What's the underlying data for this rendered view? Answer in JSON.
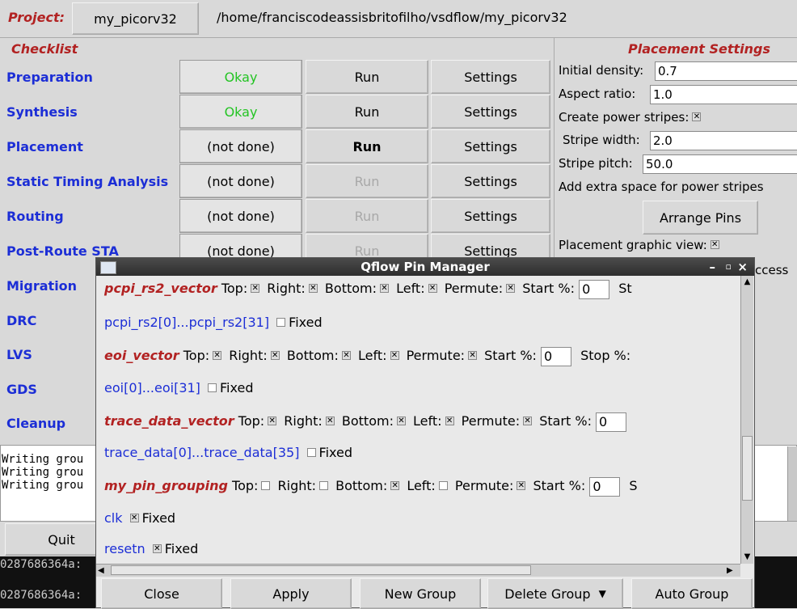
{
  "header": {
    "project_label": "Project:",
    "project_name": "my_picorv32",
    "project_path": "/home/franciscodeassisbritofilho/vsdflow/my_picorv32"
  },
  "checklist": {
    "title": "Checklist",
    "rows": [
      {
        "label": "Preparation",
        "status": "Okay",
        "run": "Run",
        "settings": "Settings"
      },
      {
        "label": "Synthesis",
        "status": "Okay",
        "run": "Run",
        "settings": "Settings"
      },
      {
        "label": "Placement",
        "status": "(not done)",
        "run": "Run",
        "settings": "Settings"
      },
      {
        "label": "Static Timing Analysis",
        "status": "(not done)",
        "run": "Run",
        "settings": "Settings"
      },
      {
        "label": "Routing",
        "status": "(not done)",
        "run": "Run",
        "settings": "Settings"
      },
      {
        "label": "Post-Route STA",
        "status": "(not done)",
        "run": "Run",
        "settings": "Settings"
      },
      {
        "label": "Migration"
      },
      {
        "label": "DRC"
      },
      {
        "label": "LVS"
      },
      {
        "label": "GDS"
      },
      {
        "label": "Cleanup"
      }
    ]
  },
  "placement_settings": {
    "title": "Placement Settings",
    "initial_density_label": "Initial density:",
    "initial_density": "0.7",
    "aspect_ratio_label": "Aspect ratio:",
    "aspect_ratio": "1.0",
    "power_stripes_label": "Create power stripes:",
    "stripe_width_label": "Stripe width:",
    "stripe_width": "2.0",
    "stripe_pitch_label": "Stripe pitch:",
    "stripe_pitch": "50.0",
    "extra_space_label": "Add extra space for power stripes",
    "arrange_pins": "Arrange Pins",
    "graphic_view_label": "Placement graphic view:",
    "partial_text": "ccess"
  },
  "log": {
    "lines": [
      "Writing grou",
      "Writing grou",
      "Writing grou"
    ]
  },
  "quit": "Quit",
  "terminal": {
    "lines": [
      "0287686364a:",
      "0287686364a:"
    ]
  },
  "dialog": {
    "title": "Qflow Pin Manager",
    "lbl": {
      "top": "Top:",
      "right": "Right:",
      "bottom": "Bottom:",
      "left": "Left:",
      "permute": "Permute:",
      "start": "Start %:",
      "stop": "Stop %:",
      "st_partial": "St",
      "s_partial": "S",
      "fixed": "Fixed"
    },
    "groups": [
      {
        "name": "pcpi_rs2_vector",
        "pins": "pcpi_rs2[0]...pcpi_rs2[31]",
        "start": "0"
      },
      {
        "name": "eoi_vector",
        "pins": "eoi[0]...eoi[31]",
        "start": "0"
      },
      {
        "name": "trace_data_vector",
        "pins": "trace_data[0]...trace_data[35]",
        "start": "0"
      },
      {
        "name": "my_pin_grouping",
        "start": "0"
      }
    ],
    "single_pins": [
      "clk",
      "resetn"
    ],
    "buttons": {
      "close": "Close",
      "apply": "Apply",
      "new_group": "New Group",
      "delete_group": "Delete Group",
      "auto_group": "Auto Group"
    }
  }
}
